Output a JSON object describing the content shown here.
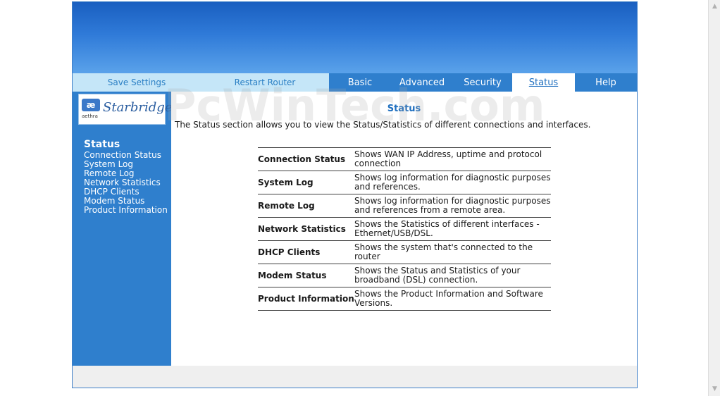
{
  "nav": {
    "save_settings": "Save Settings",
    "restart_router": "Restart Router",
    "tabs": [
      "Basic",
      "Advanced",
      "Security",
      "Status",
      "Help"
    ],
    "active_tab": "Status"
  },
  "logo": {
    "mark": "æ",
    "company": "aethra",
    "product": "Starbridge"
  },
  "sidebar": {
    "heading": "Status",
    "links": [
      "Connection Status",
      "System Log",
      "Remote Log",
      "Network Statistics",
      "DHCP Clients",
      "Modem Status",
      "Product Information"
    ]
  },
  "main": {
    "title": "Status",
    "intro": "The Status section allows you to view the Status/Statistics of different connections and interfaces.",
    "rows": [
      {
        "name": "Connection Status",
        "desc": "Shows WAN IP Address, uptime and protocol connection"
      },
      {
        "name": "System Log",
        "desc": "Shows log information for diagnostic purposes and references."
      },
      {
        "name": "Remote Log",
        "desc": "Shows log information for diagnostic purposes and references from a remote area."
      },
      {
        "name": "Network Statistics",
        "desc": "Shows the Statistics of different interfaces - Ethernet/USB/DSL."
      },
      {
        "name": "DHCP Clients",
        "desc": "Shows the system that's connected to the router"
      },
      {
        "name": "Modem Status",
        "desc": "Shows the Status and Statistics of your broadband (DSL) connection."
      },
      {
        "name": "Product Information",
        "desc": "Shows the Product Information and Software Versions."
      }
    ]
  },
  "watermark": "PcWinTech.com",
  "colors": {
    "banner_top": "#1a5fc0",
    "nav_blue": "#2f7fcd",
    "util_bg": "#c5e6f8",
    "title_blue": "#1f6fbf"
  },
  "icons": {
    "scroll_up": "arrow-up-icon",
    "scroll_down": "arrow-down-icon"
  }
}
